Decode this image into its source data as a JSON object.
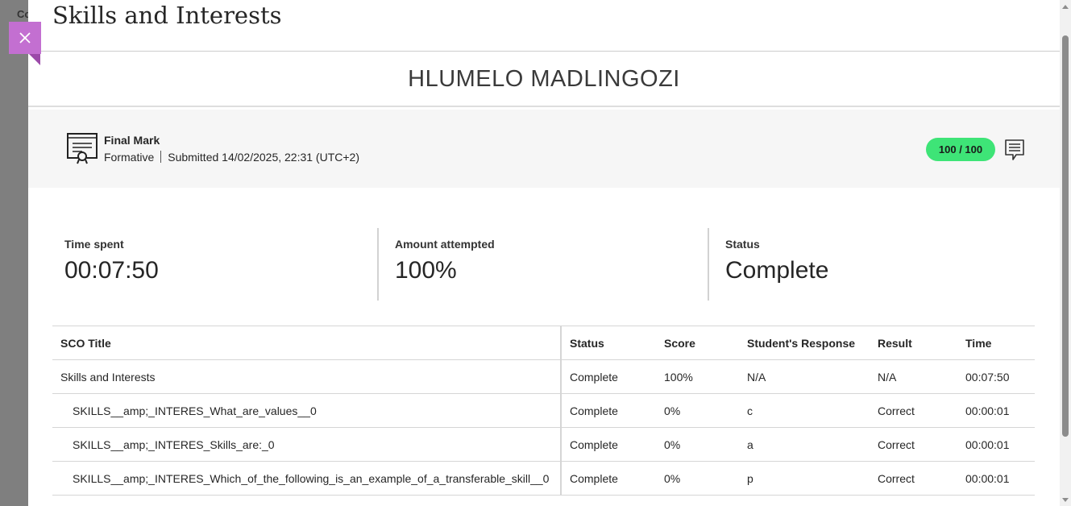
{
  "background": {
    "partial_text": "Co"
  },
  "close_button": {
    "icon": "close-icon",
    "color": "#c36fd1"
  },
  "panel": {
    "title": "Skills and Interests"
  },
  "student": {
    "name": "HLUMELO MADLINGOZI"
  },
  "grade": {
    "title": "Final Mark",
    "type": "Formative",
    "submitted": "Submitted 14/02/2025, 22:31 (UTC+2)",
    "score": "100 / 100",
    "score_color": "#3ee477"
  },
  "stats": [
    {
      "label": "Time spent",
      "value": "00:07:50"
    },
    {
      "label": "Amount attempted",
      "value": "100%"
    },
    {
      "label": "Status",
      "value": "Complete"
    }
  ],
  "table": {
    "headers": [
      "SCO Title",
      "Status",
      "Score",
      "Student's Response",
      "Result",
      "Time"
    ],
    "rows": [
      [
        "Skills and Interests",
        "Complete",
        "100%",
        "N/A",
        "N/A",
        "00:07:50"
      ],
      [
        "SKILLS__amp;_INTERES_What_are_values__0",
        "Complete",
        "0%",
        "c",
        "Correct",
        "00:00:01"
      ],
      [
        "SKILLS__amp;_INTERES_Skills_are:_0",
        "Complete",
        "0%",
        "a",
        "Correct",
        "00:00:01"
      ],
      [
        "SKILLS__amp;_INTERES_Which_of_the_following_is_an_example_of_a_transferable_skill__0",
        "Complete",
        "0%",
        "p",
        "Correct",
        "00:00:01"
      ]
    ]
  }
}
